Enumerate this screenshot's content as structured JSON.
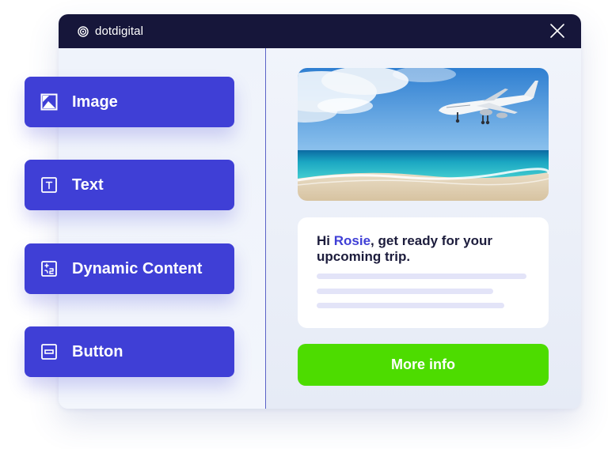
{
  "header": {
    "brand": "dotdigital",
    "logo_icon": "spiral-logo-icon",
    "close_icon": "close-icon"
  },
  "blocks": [
    {
      "label": "Image",
      "icon": "image-icon"
    },
    {
      "label": "Text",
      "icon": "text-icon"
    },
    {
      "label": "Dynamic Content",
      "icon": "dynamic-content-icon"
    },
    {
      "label": "Button",
      "icon": "button-icon"
    }
  ],
  "preview": {
    "hero_image": "beach-airplane-photo",
    "greeting_prefix": "Hi ",
    "greeting_name": "Rosie",
    "greeting_suffix": ", get ready for your upcoming trip.",
    "cta_label": "More info"
  },
  "colors": {
    "titlebar": "#16163a",
    "accent": "#3f3fd6",
    "cta": "#4ddc00"
  }
}
